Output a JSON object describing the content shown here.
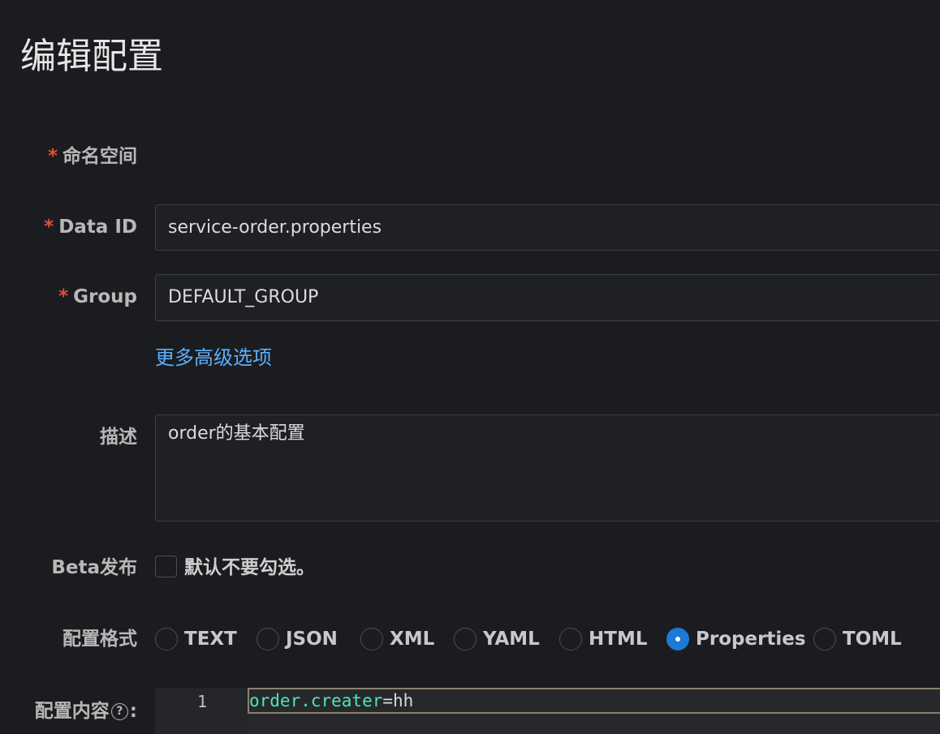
{
  "page": {
    "title": "编辑配置"
  },
  "form": {
    "namespace": {
      "required_mark": "*",
      "label": "命名空间"
    },
    "data_id": {
      "required_mark": "*",
      "label": "Data ID",
      "value": "service-order.properties"
    },
    "group": {
      "required_mark": "*",
      "label": "Group",
      "value": "DEFAULT_GROUP"
    },
    "advanced_link": "更多高级选项",
    "description": {
      "label": "描述",
      "value": "order的基本配置"
    },
    "beta": {
      "label": "Beta发布",
      "checkbox_text": "默认不要勾选。",
      "checked": false
    },
    "format": {
      "label": "配置格式",
      "options": [
        "TEXT",
        "JSON",
        "XML",
        "YAML",
        "HTML",
        "Properties",
        "TOML"
      ],
      "selected": "Properties"
    },
    "content": {
      "label": "配置内容",
      "help_icon": "?",
      "colon": ":",
      "line_number": "1",
      "code_key": "order.creater",
      "code_op": "=",
      "code_value": "hh"
    }
  },
  "colors": {
    "accent": "#1e78d6",
    "link": "#5ab0ff",
    "required": "#e0503a",
    "code_key": "#4fe6b3"
  }
}
